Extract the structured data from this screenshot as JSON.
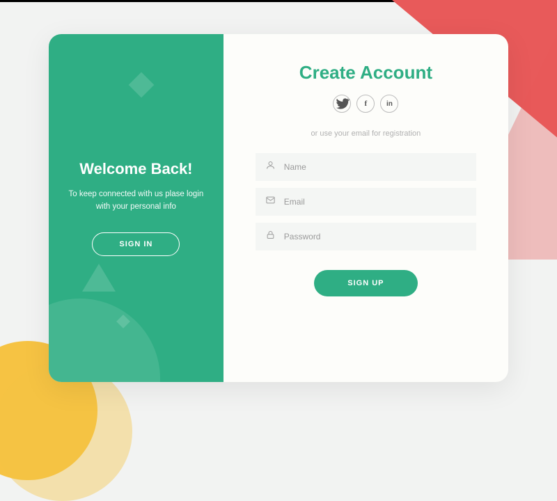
{
  "left": {
    "title": "Welcome Back!",
    "subtitle": "To keep connected with us plase login with your personal info",
    "button": "SIGN IN"
  },
  "right": {
    "title": "Create Account",
    "hint": "or use your email for registration",
    "fields": {
      "name": "Name",
      "email": "Email",
      "password": "Password"
    },
    "button": "SIGN UP"
  },
  "socials": {
    "twitter": "twitter-icon",
    "facebook": "facebook-icon",
    "linkedin": "linkedin-icon"
  },
  "colors": {
    "accent": "#2fae84",
    "red": "#e85a5a",
    "yellow": "#f6c343"
  }
}
